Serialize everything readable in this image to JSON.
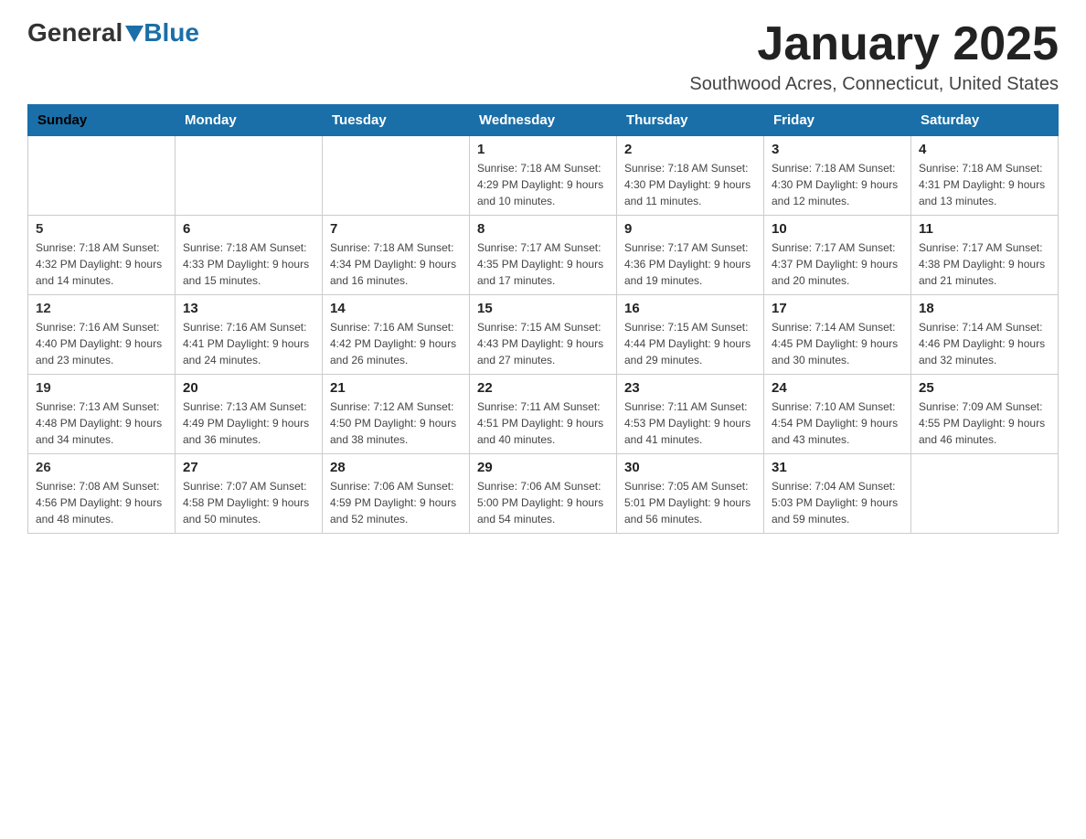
{
  "logo": {
    "general": "General",
    "blue": "Blue"
  },
  "title": "January 2025",
  "location": "Southwood Acres, Connecticut, United States",
  "headers": [
    "Sunday",
    "Monday",
    "Tuesday",
    "Wednesday",
    "Thursday",
    "Friday",
    "Saturday"
  ],
  "weeks": [
    [
      {
        "day": "",
        "info": ""
      },
      {
        "day": "",
        "info": ""
      },
      {
        "day": "",
        "info": ""
      },
      {
        "day": "1",
        "info": "Sunrise: 7:18 AM\nSunset: 4:29 PM\nDaylight: 9 hours\nand 10 minutes."
      },
      {
        "day": "2",
        "info": "Sunrise: 7:18 AM\nSunset: 4:30 PM\nDaylight: 9 hours\nand 11 minutes."
      },
      {
        "day": "3",
        "info": "Sunrise: 7:18 AM\nSunset: 4:30 PM\nDaylight: 9 hours\nand 12 minutes."
      },
      {
        "day": "4",
        "info": "Sunrise: 7:18 AM\nSunset: 4:31 PM\nDaylight: 9 hours\nand 13 minutes."
      }
    ],
    [
      {
        "day": "5",
        "info": "Sunrise: 7:18 AM\nSunset: 4:32 PM\nDaylight: 9 hours\nand 14 minutes."
      },
      {
        "day": "6",
        "info": "Sunrise: 7:18 AM\nSunset: 4:33 PM\nDaylight: 9 hours\nand 15 minutes."
      },
      {
        "day": "7",
        "info": "Sunrise: 7:18 AM\nSunset: 4:34 PM\nDaylight: 9 hours\nand 16 minutes."
      },
      {
        "day": "8",
        "info": "Sunrise: 7:17 AM\nSunset: 4:35 PM\nDaylight: 9 hours\nand 17 minutes."
      },
      {
        "day": "9",
        "info": "Sunrise: 7:17 AM\nSunset: 4:36 PM\nDaylight: 9 hours\nand 19 minutes."
      },
      {
        "day": "10",
        "info": "Sunrise: 7:17 AM\nSunset: 4:37 PM\nDaylight: 9 hours\nand 20 minutes."
      },
      {
        "day": "11",
        "info": "Sunrise: 7:17 AM\nSunset: 4:38 PM\nDaylight: 9 hours\nand 21 minutes."
      }
    ],
    [
      {
        "day": "12",
        "info": "Sunrise: 7:16 AM\nSunset: 4:40 PM\nDaylight: 9 hours\nand 23 minutes."
      },
      {
        "day": "13",
        "info": "Sunrise: 7:16 AM\nSunset: 4:41 PM\nDaylight: 9 hours\nand 24 minutes."
      },
      {
        "day": "14",
        "info": "Sunrise: 7:16 AM\nSunset: 4:42 PM\nDaylight: 9 hours\nand 26 minutes."
      },
      {
        "day": "15",
        "info": "Sunrise: 7:15 AM\nSunset: 4:43 PM\nDaylight: 9 hours\nand 27 minutes."
      },
      {
        "day": "16",
        "info": "Sunrise: 7:15 AM\nSunset: 4:44 PM\nDaylight: 9 hours\nand 29 minutes."
      },
      {
        "day": "17",
        "info": "Sunrise: 7:14 AM\nSunset: 4:45 PM\nDaylight: 9 hours\nand 30 minutes."
      },
      {
        "day": "18",
        "info": "Sunrise: 7:14 AM\nSunset: 4:46 PM\nDaylight: 9 hours\nand 32 minutes."
      }
    ],
    [
      {
        "day": "19",
        "info": "Sunrise: 7:13 AM\nSunset: 4:48 PM\nDaylight: 9 hours\nand 34 minutes."
      },
      {
        "day": "20",
        "info": "Sunrise: 7:13 AM\nSunset: 4:49 PM\nDaylight: 9 hours\nand 36 minutes."
      },
      {
        "day": "21",
        "info": "Sunrise: 7:12 AM\nSunset: 4:50 PM\nDaylight: 9 hours\nand 38 minutes."
      },
      {
        "day": "22",
        "info": "Sunrise: 7:11 AM\nSunset: 4:51 PM\nDaylight: 9 hours\nand 40 minutes."
      },
      {
        "day": "23",
        "info": "Sunrise: 7:11 AM\nSunset: 4:53 PM\nDaylight: 9 hours\nand 41 minutes."
      },
      {
        "day": "24",
        "info": "Sunrise: 7:10 AM\nSunset: 4:54 PM\nDaylight: 9 hours\nand 43 minutes."
      },
      {
        "day": "25",
        "info": "Sunrise: 7:09 AM\nSunset: 4:55 PM\nDaylight: 9 hours\nand 46 minutes."
      }
    ],
    [
      {
        "day": "26",
        "info": "Sunrise: 7:08 AM\nSunset: 4:56 PM\nDaylight: 9 hours\nand 48 minutes."
      },
      {
        "day": "27",
        "info": "Sunrise: 7:07 AM\nSunset: 4:58 PM\nDaylight: 9 hours\nand 50 minutes."
      },
      {
        "day": "28",
        "info": "Sunrise: 7:06 AM\nSunset: 4:59 PM\nDaylight: 9 hours\nand 52 minutes."
      },
      {
        "day": "29",
        "info": "Sunrise: 7:06 AM\nSunset: 5:00 PM\nDaylight: 9 hours\nand 54 minutes."
      },
      {
        "day": "30",
        "info": "Sunrise: 7:05 AM\nSunset: 5:01 PM\nDaylight: 9 hours\nand 56 minutes."
      },
      {
        "day": "31",
        "info": "Sunrise: 7:04 AM\nSunset: 5:03 PM\nDaylight: 9 hours\nand 59 minutes."
      },
      {
        "day": "",
        "info": ""
      }
    ]
  ]
}
